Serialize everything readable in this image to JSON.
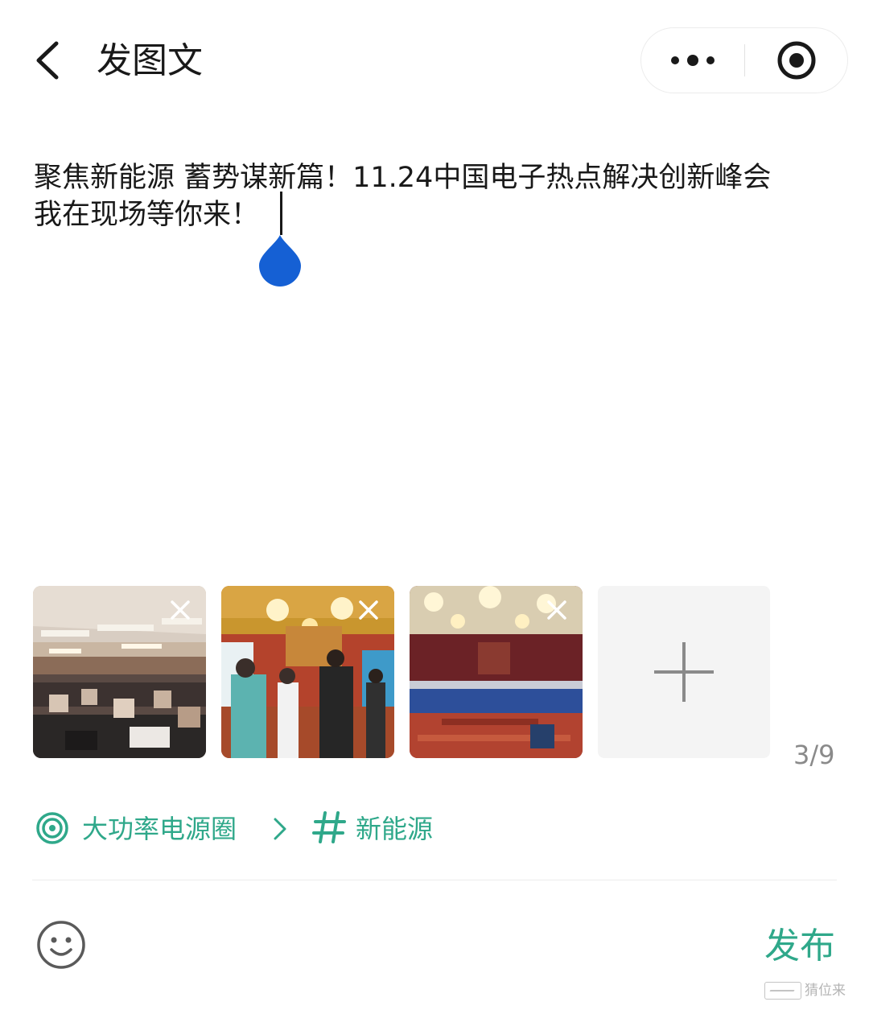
{
  "header": {
    "title": "发图文",
    "back_icon": "chevron-left-icon",
    "capsule": {
      "more_icon": "more-dots-icon",
      "close_icon": "target-icon"
    }
  },
  "post": {
    "text": "聚焦新能源 蓄势谋新篇！11.24中国电子热点解决创新峰会\n我在现场等你来！"
  },
  "images": {
    "items": [
      {
        "name": "conference-hall-photo",
        "remove_icon": "close-icon"
      },
      {
        "name": "exhibition-crowd-photo",
        "remove_icon": "close-icon"
      },
      {
        "name": "banquet-hall-photo",
        "remove_icon": "close-icon"
      }
    ],
    "add_icon": "plus-icon",
    "count": "3/9"
  },
  "topic": {
    "circle_icon": "circle-ring-icon",
    "circle_label": "大功率电源圈",
    "separator_icon": "chevron-right-icon",
    "hashtag_icon": "hashtag-icon",
    "hashtag_label": "新能源"
  },
  "footer": {
    "emoji_icon": "smiley-icon",
    "publish_label": "发布"
  },
  "watermark": {
    "text": "猜位来"
  },
  "colors": {
    "accent": "#2fa88a",
    "cursor_handle": "#1560d4",
    "text": "#191919"
  }
}
